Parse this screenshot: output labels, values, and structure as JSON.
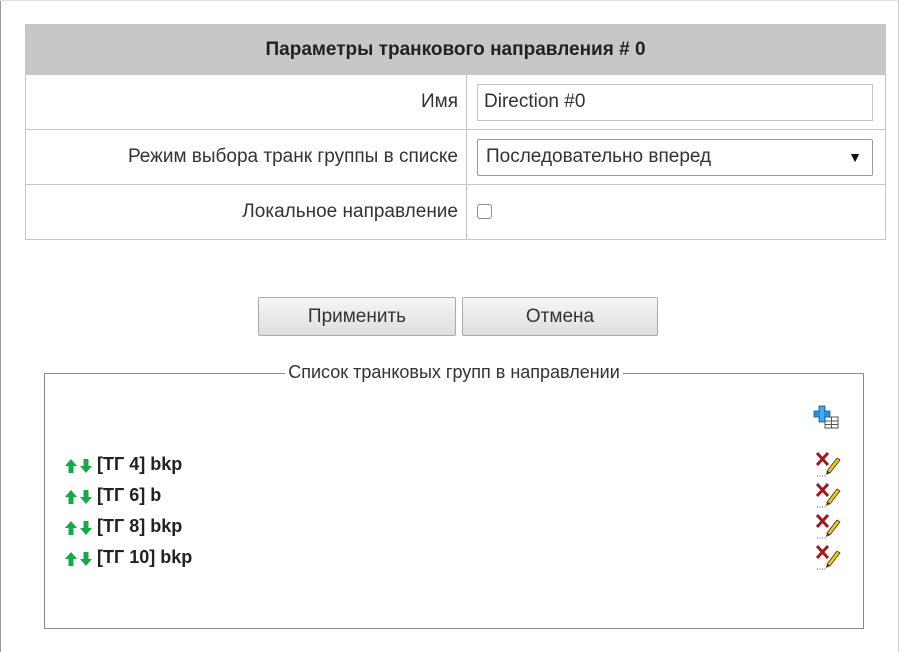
{
  "form": {
    "title": "Параметры транкового направления # 0",
    "name_label": "Имя",
    "name_value": "Direction #0",
    "mode_label": "Режим выбора транк группы в списке",
    "mode_value": "Последовательно вперед",
    "local_label": "Локальное направление",
    "local_checked": false
  },
  "buttons": {
    "apply": "Применить",
    "cancel": "Отмена"
  },
  "trunk_groups": {
    "legend": "Список транковых групп в направлении",
    "add_icon": "add-table-icon",
    "move_icon": "up-down-arrows-icon",
    "delete_icon": "delete-edit-icon",
    "items": [
      {
        "name": "[ТГ 4] bkp"
      },
      {
        "name": "[ТГ 6] b"
      },
      {
        "name": "[ТГ 8] bkp"
      },
      {
        "name": "[ТГ 10] bkp"
      }
    ]
  },
  "colors": {
    "header_bg": "#c7c7c7",
    "arrow_green": "#1aa64a",
    "delete_red": "#9b1c1c",
    "add_blue": "#2a8fd6"
  }
}
